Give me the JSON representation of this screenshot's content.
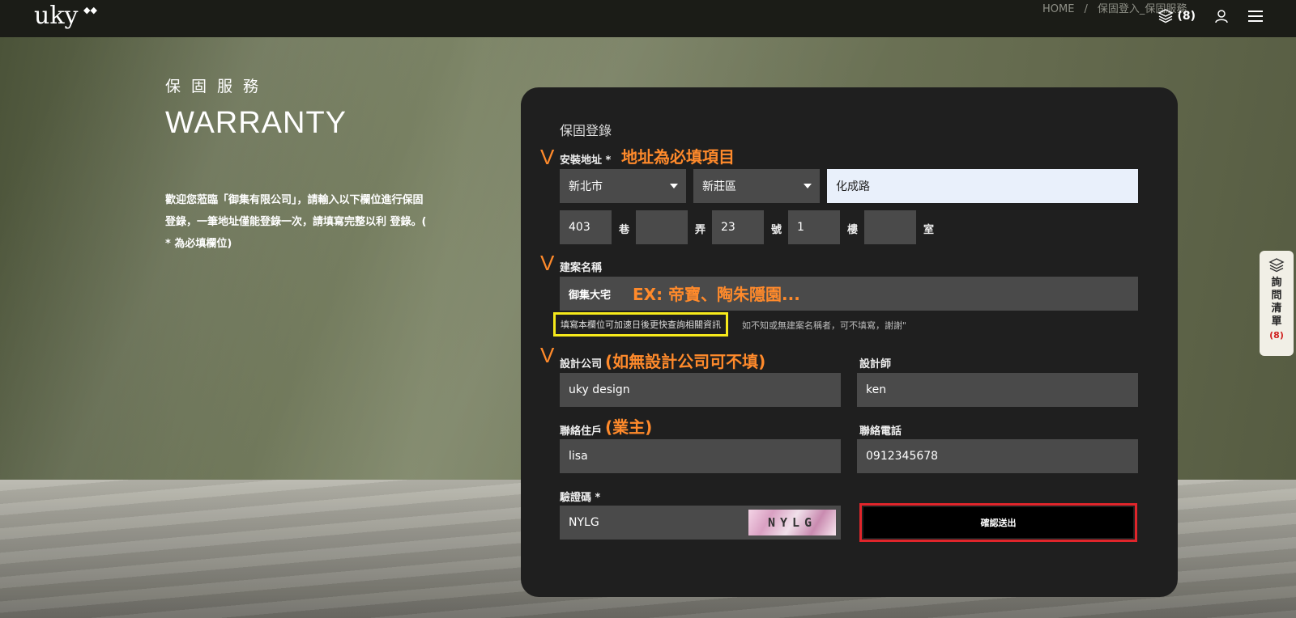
{
  "header": {
    "logo": "uky",
    "logo_mark": "◆◆",
    "breadcrumb": [
      "HOME",
      "/",
      "保固登入_保固服務"
    ],
    "cart_count": "(8)"
  },
  "hero": {
    "zh_title": "保固服務",
    "en_title": "WARRANTY",
    "intro": "歡迎您蒞臨「御集有限公司」，請輸入以下欄位進行保固登錄，一筆地址僅能登錄一次，請填寫完整以利 登錄。( * 為必填欄位)"
  },
  "form": {
    "title": "保固登錄",
    "address": {
      "label": "安裝地址 *",
      "annotation": "地址為必填項目",
      "city": "新北市",
      "district": "新莊區",
      "road": "化成路",
      "lane": "403",
      "lane_unit": "巷",
      "alley": "",
      "alley_unit": "弄",
      "number": "23",
      "number_unit": "號",
      "floor": "1",
      "floor_unit": "樓",
      "room": "",
      "room_unit": "室"
    },
    "project": {
      "label": "建案名稱",
      "value": "御集大宅",
      "annotation": "EX: 帝寶、陶朱隱園...",
      "highlight_note": "填寫本欄位可加速日後更快查詢相關資訊",
      "hint": "如不知或無建案名稱者，可不填寫，謝謝\""
    },
    "design_company": {
      "label": "設計公司",
      "annotation": "(如無設計公司可不填)",
      "value": "uky design"
    },
    "designer": {
      "label": "設計師",
      "value": "ken"
    },
    "resident": {
      "label": "聯絡住戶",
      "annotation": "(業主)",
      "value": "lisa"
    },
    "phone": {
      "label": "聯絡電話",
      "value": "0912345678"
    },
    "captcha": {
      "label": "驗證碼 *",
      "value": "NYLG",
      "image_text": "NYLG"
    },
    "submit_label": "確認送出",
    "check_mark": "V"
  },
  "side_panel": {
    "label": "詢問清單",
    "count": "(8)"
  }
}
